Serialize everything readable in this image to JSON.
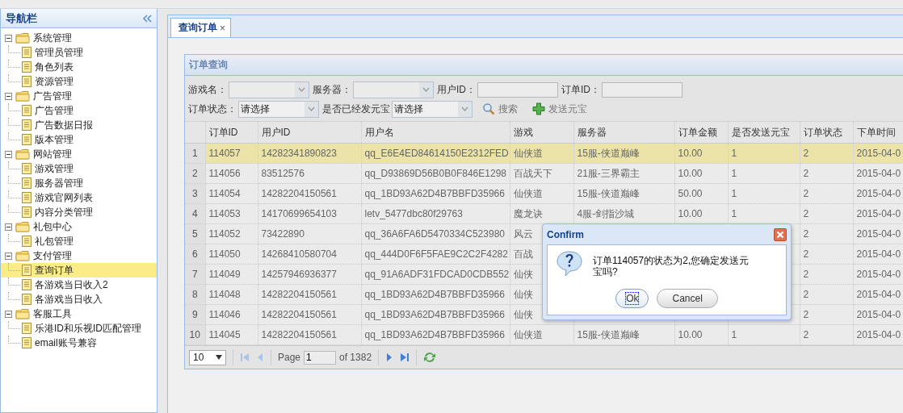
{
  "nav": {
    "title": "导航栏",
    "tree": [
      {
        "label": "系统管理",
        "expanded": true,
        "children": [
          {
            "label": "管理员管理",
            "selected": false
          },
          {
            "label": "角色列表",
            "selected": false
          },
          {
            "label": "资源管理",
            "selected": false
          }
        ]
      },
      {
        "label": "广告管理",
        "expanded": true,
        "children": [
          {
            "label": "广告管理",
            "selected": false
          },
          {
            "label": "广告数据日报",
            "selected": false
          },
          {
            "label": "版本管理",
            "selected": false
          }
        ]
      },
      {
        "label": "网站管理",
        "expanded": true,
        "children": [
          {
            "label": "游戏管理",
            "selected": false
          },
          {
            "label": "服务器管理",
            "selected": false
          },
          {
            "label": "游戏官网列表",
            "selected": false
          },
          {
            "label": "内容分类管理",
            "selected": false
          }
        ]
      },
      {
        "label": "礼包中心",
        "expanded": true,
        "children": [
          {
            "label": "礼包管理",
            "selected": false
          }
        ]
      },
      {
        "label": "支付管理",
        "expanded": true,
        "children": [
          {
            "label": "查询订单",
            "selected": true
          },
          {
            "label": "各游戏当日收入2",
            "selected": false
          },
          {
            "label": "各游戏当日收入",
            "selected": false
          }
        ]
      },
      {
        "label": "客服工具",
        "expanded": true,
        "children": [
          {
            "label": "乐港ID和乐视ID匹配管理",
            "selected": false
          },
          {
            "label": "email账号兼容",
            "selected": false
          }
        ]
      }
    ]
  },
  "tabs": [
    {
      "label": "查询订单",
      "selected": true,
      "close": "×"
    }
  ],
  "panel": {
    "title": "订单查询"
  },
  "filters": [
    [
      {
        "kind": "select",
        "label": "游戏名："
      },
      {
        "kind": "select",
        "label": "服务器："
      },
      {
        "kind": "text",
        "label": "用户ID："
      },
      {
        "kind": "text",
        "label": "订单ID："
      }
    ],
    [
      {
        "kind": "select",
        "label": "订单状态：",
        "value": "请选择"
      },
      {
        "kind": "select",
        "label": "是否已经发元宝",
        "value": "请选择"
      },
      {
        "kind": "search",
        "label": "搜索"
      },
      {
        "kind": "add",
        "label": "发送元宝"
      }
    ]
  ],
  "table": {
    "columns": [
      "订单ID",
      "用户ID",
      "用户名",
      "游戏",
      "服务器",
      "订单金额",
      "是否发送元宝",
      "订单状态",
      "下单时间"
    ],
    "rows": [
      {
        "num": "1",
        "selected": true,
        "cells": [
          "114057",
          "14282341890823",
          "qq_E6E4ED84614150E2312FED",
          "仙侠道",
          "15服-侠道巅峰",
          "10.00",
          "1",
          "2",
          "2015-04-0"
        ]
      },
      {
        "num": "2",
        "selected": false,
        "cells": [
          "114056",
          "83512576",
          "qq_D93869D56B0B0F846E1298",
          "百战天下",
          "21服-三界霸主",
          "10.00",
          "1",
          "2",
          "2015-04-0"
        ]
      },
      {
        "num": "3",
        "selected": false,
        "cells": [
          "114054",
          "14282204150561",
          "qq_1BD93A62D4B7BBFD35966",
          "仙侠道",
          "15服-侠道巅峰",
          "50.00",
          "1",
          "2",
          "2015-04-0"
        ]
      },
      {
        "num": "4",
        "selected": false,
        "cells": [
          "114053",
          "14170699654103",
          "letv_5477dbc80f29763",
          "魔龙诀",
          "4服-剑指沙城",
          "10.00",
          "1",
          "2",
          "2015-04-0"
        ]
      },
      {
        "num": "5",
        "selected": false,
        "cells": [
          "114052",
          "73422890",
          "qq_36A6FA6D5470334C523980",
          "风云",
          null,
          null,
          null,
          "2",
          "2015-04-0"
        ]
      },
      {
        "num": "6",
        "selected": false,
        "cells": [
          "114050",
          "14268410580704",
          "qq_444D0F6F5FAE9C2C2F4282",
          "百战",
          null,
          null,
          null,
          "2",
          "2015-04-0"
        ]
      },
      {
        "num": "7",
        "selected": false,
        "cells": [
          "114049",
          "14257946936377",
          "qq_91A6ADF31FDCAD0CDB552",
          "仙侠",
          null,
          null,
          null,
          "2",
          "2015-04-0"
        ]
      },
      {
        "num": "8",
        "selected": false,
        "cells": [
          "114048",
          "14282204150561",
          "qq_1BD93A62D4B7BBFD35966",
          "仙侠",
          null,
          null,
          null,
          "2",
          "2015-04-0"
        ]
      },
      {
        "num": "9",
        "selected": false,
        "cells": [
          "114046",
          "14282204150561",
          "qq_1BD93A62D4B7BBFD35966",
          "仙侠",
          null,
          null,
          null,
          "2",
          "2015-04-0"
        ]
      },
      {
        "num": "10",
        "selected": false,
        "cells": [
          "114045",
          "14282204150561",
          "qq_1BD93A62D4B7BBFD35966",
          "仙侠道",
          "15服-侠道巅峰",
          "10.00",
          "1",
          "2",
          "2015-04-0"
        ]
      }
    ]
  },
  "pager": {
    "page_size": "10",
    "page_label": "Page",
    "page": "1",
    "total": "of 1382"
  },
  "dialog": {
    "title": "Confirm",
    "message": "订单114057的状态为2,您确定发送元宝吗?",
    "buttons": [
      {
        "label": "Ok",
        "focused": true
      },
      {
        "label": "Cancel",
        "focused": false
      }
    ]
  }
}
